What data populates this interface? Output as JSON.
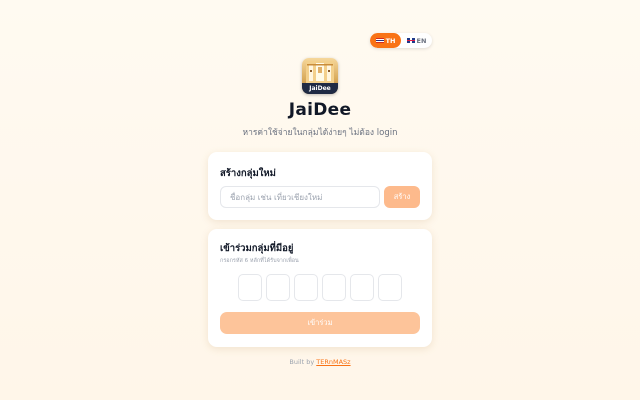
{
  "lang": {
    "th_label": "TH",
    "en_label": "EN",
    "active": "TH"
  },
  "logo": {
    "text": "JaiDee"
  },
  "app": {
    "title": "JaiDee",
    "subtitle": "หารค่าใช้จ่ายในกลุ่มได้ง่ายๆ ไม่ต้อง login"
  },
  "create": {
    "title": "สร้างกลุ่มใหม่",
    "placeholder": "ชื่อกลุ่ม เช่น เที่ยวเชียงใหม่",
    "value": "",
    "button_label": "สร้าง"
  },
  "join": {
    "title": "เข้าร่วมกลุ่มที่มีอยู่",
    "hint": "กรอกรหัส 6 หลักที่ได้รับจากเพื่อน",
    "code_digits": [
      "",
      "",
      "",
      "",
      "",
      ""
    ],
    "button_label": "เข้าร่วม"
  },
  "footer": {
    "prefix": "Built by",
    "link_text": "TERnMASz"
  },
  "colors": {
    "accent": "#f97316",
    "button_disabled": "#fdba8c",
    "background": "#fff8ee"
  }
}
